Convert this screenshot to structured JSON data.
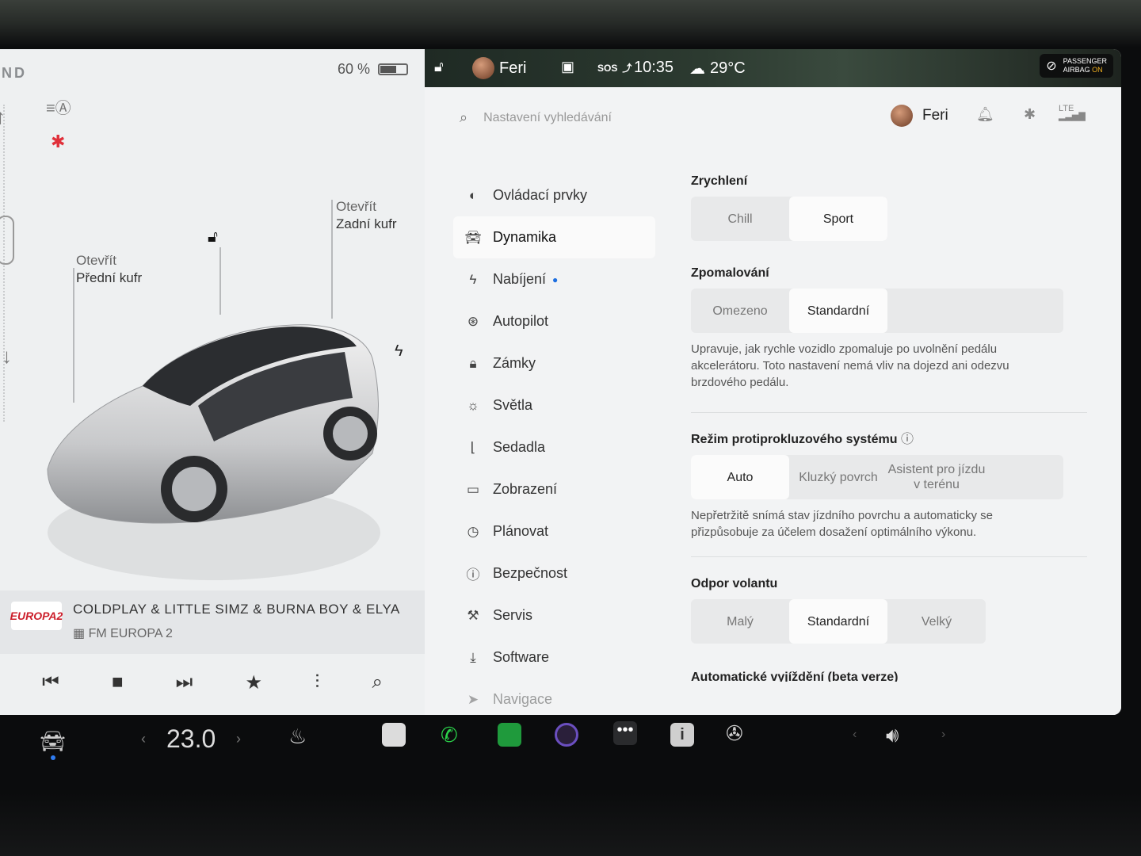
{
  "left": {
    "gear": "ND",
    "battery_percent": "60 %",
    "battery_level": 0.6,
    "callout_front": {
      "action": "Otevřít",
      "target": "Přední kufr"
    },
    "callout_rear": {
      "action": "Otevřít",
      "target": "Zadní kufr"
    },
    "media": {
      "logo": "EUROPA2",
      "title": "COLDPLAY & LITTLE SIMZ & BURNA BOY & ELYA",
      "station": "FM EUROPA 2"
    }
  },
  "topbar": {
    "user": "Feri",
    "sos": "SOS",
    "time": "10:35",
    "temperature": "29°C",
    "airbag_line1": "PASSENGER",
    "airbag_line2": "AIRBAG",
    "airbag_state": "ON"
  },
  "settings": {
    "search_placeholder": "Nastavení vyhledávání",
    "user": "Feri",
    "signal": "LTE",
    "nav": [
      {
        "label": "Ovládací prvky",
        "icon": "toggle-icon"
      },
      {
        "label": "Dynamika",
        "icon": "car-icon"
      },
      {
        "label": "Nabíjení",
        "icon": "bolt-icon"
      },
      {
        "label": "Autopilot",
        "icon": "steering-wheel-icon"
      },
      {
        "label": "Zámky",
        "icon": "lock-icon"
      },
      {
        "label": "Světla",
        "icon": "sun-icon"
      },
      {
        "label": "Sedadla",
        "icon": "seat-icon"
      },
      {
        "label": "Zobrazení",
        "icon": "display-icon"
      },
      {
        "label": "Plánovat",
        "icon": "clock-icon"
      },
      {
        "label": "Bezpečnost",
        "icon": "alert-icon"
      },
      {
        "label": "Servis",
        "icon": "wrench-icon"
      },
      {
        "label": "Software",
        "icon": "download-icon"
      },
      {
        "label": "Navigace",
        "icon": "navigation-icon"
      }
    ],
    "acceleration": {
      "title": "Zrychlení",
      "options": [
        "Chill",
        "Sport"
      ],
      "selected": "Sport"
    },
    "regen": {
      "title": "Zpomalování",
      "options": [
        "Omezeno",
        "Standardní"
      ],
      "selected": "Standardní",
      "desc": "Upravuje, jak rychle vozidlo zpomaluje po uvolnění pedálu akcelerátoru. Toto nastavení nemá vliv na dojezd ani odezvu brzdového pedálu."
    },
    "traction": {
      "title": "Režim protiprokluzového systému",
      "options": [
        "Auto",
        "Kluzký povrch",
        "Asistent pro jízdu v terénu"
      ],
      "selected": "Auto",
      "desc": "Nepřetržitě snímá stav jízdního povrchu a automaticky se přizpůsobuje za účelem dosažení optimálního výkonu."
    },
    "steering": {
      "title": "Odpor volantu",
      "options": [
        "Malý",
        "Standardní",
        "Velký"
      ],
      "selected": "Standardní"
    },
    "next_section": "Automatické vyjíždění (beta verze)"
  },
  "dock": {
    "temperature": "23.0"
  }
}
